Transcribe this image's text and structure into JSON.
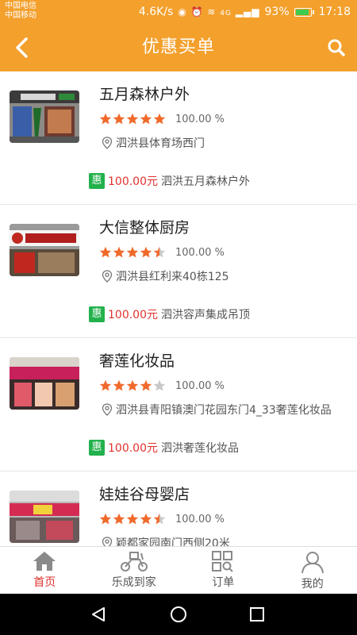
{
  "status_bar": {
    "carrier1": "中国电信",
    "carrier2": "中国移动",
    "speed": "4.6K/s",
    "network": "4G",
    "battery": "93%",
    "time": "17:18"
  },
  "header": {
    "title": "优惠买单"
  },
  "shops": [
    {
      "name": "五月森林户外",
      "rating": 5,
      "rate": "100.00 %",
      "address": "泗洪县体育场西门",
      "promo_badge": "惠",
      "promo_price": "100.00元",
      "promo_text": "泗洪五月森林户外"
    },
    {
      "name": "大信整体厨房",
      "rating": 4.5,
      "rate": "100.00 %",
      "address": "泗洪县红利来40栋125",
      "promo_badge": "惠",
      "promo_price": "100.00元",
      "promo_text": "泗洪容声集成吊顶"
    },
    {
      "name": "奢莲化妆品",
      "rating": 4,
      "rate": "100.00 %",
      "address": "泗洪县青阳镇澳门花园东门4_33奢莲化妆品",
      "promo_badge": "惠",
      "promo_price": "100.00元",
      "promo_text": "泗洪奢莲化妆品"
    },
    {
      "name": "娃娃谷母婴店",
      "rating": 4.5,
      "rate": "100.00 %",
      "address": "颖都家园南门西侧20米",
      "promo_badge": "",
      "promo_price": "",
      "promo_text": ""
    }
  ],
  "bottom_nav": [
    {
      "label": "首页",
      "icon": "home-icon",
      "active": true
    },
    {
      "label": "乐成到家",
      "icon": "scooter-icon",
      "active": false
    },
    {
      "label": "订单",
      "icon": "order-grid-icon",
      "active": false
    },
    {
      "label": "我的",
      "icon": "user-icon",
      "active": false
    }
  ],
  "colors": {
    "accent": "#f3a02c",
    "star": "#f06a2c",
    "price": "#e0322d",
    "badge": "#22b14c"
  }
}
